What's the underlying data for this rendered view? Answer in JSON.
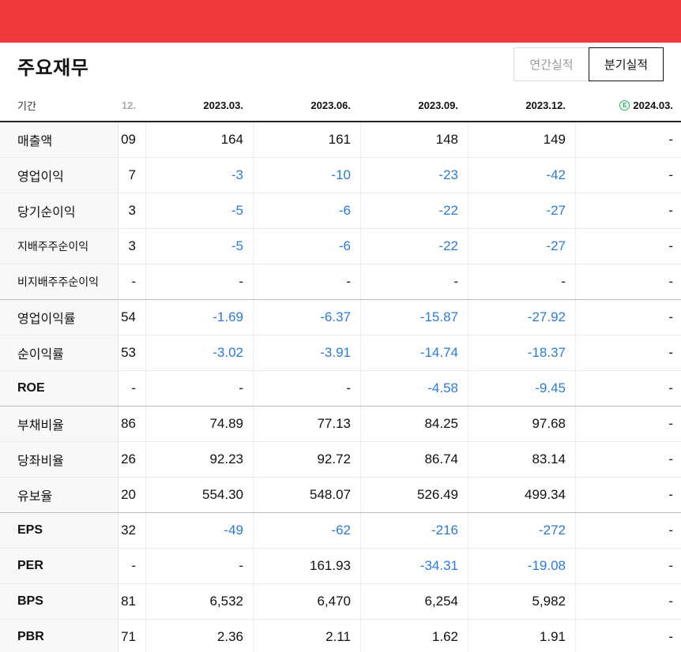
{
  "header": {
    "title": "주요재무"
  },
  "toggles": {
    "annual": "연간실적",
    "quarter": "분기실적"
  },
  "columns": {
    "label": "기간",
    "clipped": "12.",
    "periods": [
      "2023.03.",
      "2023.06.",
      "2023.09.",
      "2023.12.",
      "2024.03."
    ],
    "estimate_badge": "E"
  },
  "rows": [
    {
      "label": "매출액",
      "clipped": "09",
      "values": [
        "164",
        "161",
        "148",
        "149",
        "-"
      ]
    },
    {
      "label": "영업이익",
      "clipped": "7",
      "values": [
        "-3",
        "-10",
        "-23",
        "-42",
        "-"
      ]
    },
    {
      "label": "당기순이익",
      "clipped": "3",
      "values": [
        "-5",
        "-6",
        "-22",
        "-27",
        "-"
      ]
    },
    {
      "label": "지배주주순이익",
      "clipped": "3",
      "values": [
        "-5",
        "-6",
        "-22",
        "-27",
        "-"
      ]
    },
    {
      "label": "비지배주주순이익",
      "clipped": "-",
      "values": [
        "-",
        "-",
        "-",
        "-",
        "-"
      ]
    },
    {
      "label": "영업이익률",
      "clipped": "54",
      "values": [
        "-1.69",
        "-6.37",
        "-15.87",
        "-27.92",
        "-"
      ]
    },
    {
      "label": "순이익률",
      "clipped": "53",
      "values": [
        "-3.02",
        "-3.91",
        "-14.74",
        "-18.37",
        "-"
      ]
    },
    {
      "label": "ROE",
      "clipped": "-",
      "values": [
        "-",
        "-",
        "-4.58",
        "-9.45",
        "-"
      ]
    },
    {
      "label": "부채비율",
      "clipped": "86",
      "values": [
        "74.89",
        "77.13",
        "84.25",
        "97.68",
        "-"
      ]
    },
    {
      "label": "당좌비율",
      "clipped": "26",
      "values": [
        "92.23",
        "92.72",
        "86.74",
        "83.14",
        "-"
      ]
    },
    {
      "label": "유보율",
      "clipped": "20",
      "values": [
        "554.30",
        "548.07",
        "526.49",
        "499.34",
        "-"
      ]
    },
    {
      "label": "EPS",
      "clipped": "32",
      "values": [
        "-49",
        "-62",
        "-216",
        "-272",
        "-"
      ]
    },
    {
      "label": "PER",
      "clipped": "-",
      "values": [
        "-",
        "161.93",
        "-34.31",
        "-19.08",
        "-"
      ]
    },
    {
      "label": "BPS",
      "clipped": "81",
      "values": [
        "6,532",
        "6,470",
        "6,254",
        "5,982",
        "-"
      ]
    },
    {
      "label": "PBR",
      "clipped": "71",
      "values": [
        "2.36",
        "2.11",
        "1.62",
        "1.91",
        "-"
      ]
    }
  ],
  "colors": {
    "accent_bar": "#f1383c",
    "negative": "#2b7bd6",
    "estimate": "#19b15a"
  }
}
